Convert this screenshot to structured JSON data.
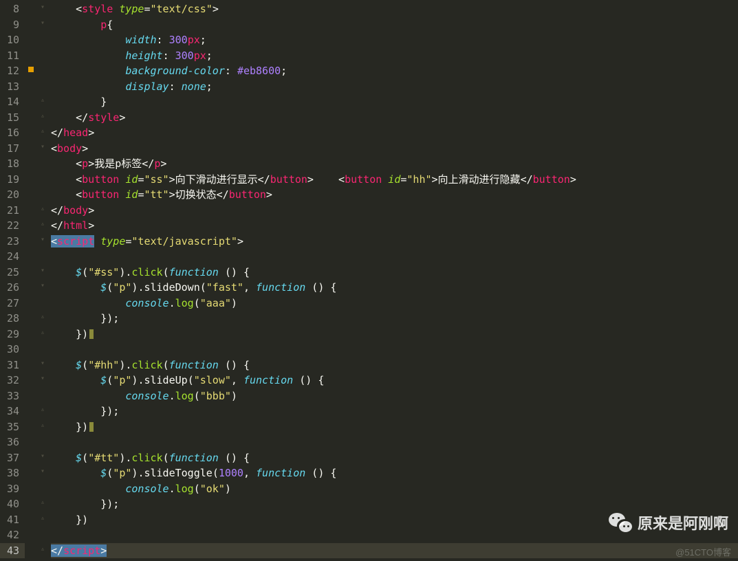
{
  "editor": {
    "first_line": 8,
    "active_line": 43,
    "marked_lines": [
      12
    ]
  },
  "watermark": {
    "text": "原来是阿刚啊",
    "credit": "@51CTO博客"
  },
  "code": {
    "lines": [
      {
        "n": 8,
        "tokens": [
          [
            "    ",
            ""
          ],
          [
            "<",
            "p-white"
          ],
          [
            "style",
            "p-tag"
          ],
          [
            " ",
            ""
          ],
          [
            "type",
            "p-attr"
          ],
          [
            "=",
            "p-white"
          ],
          [
            "\"text/css\"",
            "p-str"
          ],
          [
            ">",
            "p-white"
          ]
        ]
      },
      {
        "n": 9,
        "tokens": [
          [
            "        ",
            ""
          ],
          [
            "p",
            "p-tag"
          ],
          [
            "{",
            "p-white"
          ]
        ]
      },
      {
        "n": 10,
        "tokens": [
          [
            "            ",
            ""
          ],
          [
            "width",
            "p-prop"
          ],
          [
            ": ",
            "p-white"
          ],
          [
            "300",
            "p-num"
          ],
          [
            "px",
            "p-unit"
          ],
          [
            ";",
            "p-white"
          ]
        ]
      },
      {
        "n": 11,
        "tokens": [
          [
            "            ",
            ""
          ],
          [
            "height",
            "p-prop"
          ],
          [
            ": ",
            "p-white"
          ],
          [
            "300",
            "p-num"
          ],
          [
            "px",
            "p-unit"
          ],
          [
            ";",
            "p-white"
          ]
        ]
      },
      {
        "n": 12,
        "tokens": [
          [
            "            ",
            ""
          ],
          [
            "background-color",
            "p-prop"
          ],
          [
            ": ",
            "p-white"
          ],
          [
            "#eb8600",
            "p-num"
          ],
          [
            ";",
            "p-white"
          ]
        ]
      },
      {
        "n": 13,
        "tokens": [
          [
            "            ",
            ""
          ],
          [
            "display",
            "p-prop"
          ],
          [
            ": ",
            "p-white"
          ],
          [
            "none",
            "p-attr2"
          ],
          [
            ";",
            "p-white"
          ]
        ]
      },
      {
        "n": 14,
        "tokens": [
          [
            "        ",
            ""
          ],
          [
            "}",
            "p-white"
          ]
        ]
      },
      {
        "n": 15,
        "tokens": [
          [
            "    ",
            ""
          ],
          [
            "</",
            "p-white"
          ],
          [
            "style",
            "p-tag"
          ],
          [
            ">",
            "p-white"
          ]
        ]
      },
      {
        "n": 16,
        "tokens": [
          [
            "</",
            "p-white"
          ],
          [
            "head",
            "p-tag"
          ],
          [
            ">",
            "p-white"
          ]
        ]
      },
      {
        "n": 17,
        "tokens": [
          [
            "<",
            "p-white"
          ],
          [
            "body",
            "p-tag"
          ],
          [
            ">",
            "p-white"
          ]
        ]
      },
      {
        "n": 18,
        "tokens": [
          [
            "    ",
            ""
          ],
          [
            "<",
            "p-white"
          ],
          [
            "p",
            "p-tag"
          ],
          [
            ">",
            "p-white"
          ],
          [
            "我是p标签",
            "p-white"
          ],
          [
            "</",
            "p-white"
          ],
          [
            "p",
            "p-tag"
          ],
          [
            ">",
            "p-white"
          ]
        ]
      },
      {
        "n": 19,
        "tokens": [
          [
            "    ",
            ""
          ],
          [
            "<",
            "p-white"
          ],
          [
            "button",
            "p-tag"
          ],
          [
            " ",
            ""
          ],
          [
            "id",
            "p-attr"
          ],
          [
            "=",
            "p-white"
          ],
          [
            "\"ss\"",
            "p-str"
          ],
          [
            ">",
            "p-white"
          ],
          [
            "向下滑动进行显示",
            "p-white"
          ],
          [
            "</",
            "p-white"
          ],
          [
            "button",
            "p-tag"
          ],
          [
            ">",
            "p-white"
          ],
          [
            "    ",
            ""
          ],
          [
            "<",
            "p-white"
          ],
          [
            "button",
            "p-tag"
          ],
          [
            " ",
            ""
          ],
          [
            "id",
            "p-attr"
          ],
          [
            "=",
            "p-white"
          ],
          [
            "\"hh\"",
            "p-str"
          ],
          [
            ">",
            "p-white"
          ],
          [
            "向上滑动进行隐藏",
            "p-white"
          ],
          [
            "</",
            "p-white"
          ],
          [
            "button",
            "p-tag"
          ],
          [
            ">",
            "p-white"
          ]
        ]
      },
      {
        "n": 20,
        "tokens": [
          [
            "    ",
            ""
          ],
          [
            "<",
            "p-white"
          ],
          [
            "button",
            "p-tag"
          ],
          [
            " ",
            ""
          ],
          [
            "id",
            "p-attr"
          ],
          [
            "=",
            "p-white"
          ],
          [
            "\"tt\"",
            "p-str"
          ],
          [
            ">",
            "p-white"
          ],
          [
            "切换状态",
            "p-white"
          ],
          [
            "</",
            "p-white"
          ],
          [
            "button",
            "p-tag"
          ],
          [
            ">",
            "p-white"
          ]
        ]
      },
      {
        "n": 21,
        "tokens": [
          [
            "</",
            "p-white"
          ],
          [
            "body",
            "p-tag"
          ],
          [
            ">",
            "p-white"
          ]
        ]
      },
      {
        "n": 22,
        "tokens": [
          [
            "</",
            "p-white"
          ],
          [
            "html",
            "p-tag"
          ],
          [
            ">",
            "p-white"
          ]
        ]
      },
      {
        "n": 23,
        "tokens": [
          [
            "<",
            "p-white hl-script-open"
          ],
          [
            "script",
            "p-tag hl-script-open"
          ],
          [
            " ",
            ""
          ],
          [
            "type",
            "p-attr"
          ],
          [
            "=",
            "p-white"
          ],
          [
            "\"text/javascript\"",
            "p-str"
          ],
          [
            ">",
            "p-white"
          ]
        ]
      },
      {
        "n": 24,
        "tokens": [
          [
            "",
            ""
          ]
        ]
      },
      {
        "n": 25,
        "tokens": [
          [
            "    ",
            ""
          ],
          [
            "$",
            "p-var"
          ],
          [
            "(",
            "p-white"
          ],
          [
            "\"#ss\"",
            "p-str"
          ],
          [
            ")",
            "p-white"
          ],
          [
            ".",
            "p-white"
          ],
          [
            "click",
            "p-func"
          ],
          [
            "(",
            "p-white"
          ],
          [
            "function",
            "p-attr2"
          ],
          [
            " () {",
            "p-white"
          ]
        ]
      },
      {
        "n": 26,
        "tokens": [
          [
            "        ",
            ""
          ],
          [
            "$",
            "p-var"
          ],
          [
            "(",
            "p-white"
          ],
          [
            "\"p\"",
            "p-str"
          ],
          [
            ")",
            "p-white"
          ],
          [
            ".",
            "p-white"
          ],
          [
            "slideDown",
            "p-white"
          ],
          [
            "(",
            "p-white"
          ],
          [
            "\"fast\"",
            "p-str"
          ],
          [
            ",",
            "p-white"
          ],
          [
            " ",
            ""
          ],
          [
            "function",
            "p-attr2"
          ],
          [
            " () {",
            "p-white"
          ]
        ]
      },
      {
        "n": 27,
        "tokens": [
          [
            "            ",
            ""
          ],
          [
            "console",
            "p-var"
          ],
          [
            ".",
            "p-white"
          ],
          [
            "log",
            "p-func"
          ],
          [
            "(",
            "p-white"
          ],
          [
            "\"aaa\"",
            "p-str"
          ],
          [
            ")",
            "p-white"
          ]
        ]
      },
      {
        "n": 28,
        "tokens": [
          [
            "        ",
            ""
          ],
          [
            "});",
            "p-white"
          ]
        ]
      },
      {
        "n": 29,
        "tokens": [
          [
            "    ",
            ""
          ],
          [
            "})",
            "p-white"
          ],
          [
            " ",
            "warn-mark"
          ]
        ]
      },
      {
        "n": 30,
        "tokens": [
          [
            "",
            ""
          ]
        ]
      },
      {
        "n": 31,
        "tokens": [
          [
            "    ",
            ""
          ],
          [
            "$",
            "p-var"
          ],
          [
            "(",
            "p-white"
          ],
          [
            "\"#hh\"",
            "p-str"
          ],
          [
            ")",
            "p-white"
          ],
          [
            ".",
            "p-white"
          ],
          [
            "click",
            "p-func"
          ],
          [
            "(",
            "p-white"
          ],
          [
            "function",
            "p-attr2"
          ],
          [
            " () {",
            "p-white"
          ]
        ]
      },
      {
        "n": 32,
        "tokens": [
          [
            "        ",
            ""
          ],
          [
            "$",
            "p-var"
          ],
          [
            "(",
            "p-white"
          ],
          [
            "\"p\"",
            "p-str"
          ],
          [
            ")",
            "p-white"
          ],
          [
            ".",
            "p-white"
          ],
          [
            "slideUp",
            "p-white"
          ],
          [
            "(",
            "p-white"
          ],
          [
            "\"slow\"",
            "p-str"
          ],
          [
            ",",
            "p-white"
          ],
          [
            " ",
            ""
          ],
          [
            "function",
            "p-attr2"
          ],
          [
            " () {",
            "p-white"
          ]
        ]
      },
      {
        "n": 33,
        "tokens": [
          [
            "            ",
            ""
          ],
          [
            "console",
            "p-var"
          ],
          [
            ".",
            "p-white"
          ],
          [
            "log",
            "p-func"
          ],
          [
            "(",
            "p-white"
          ],
          [
            "\"bbb\"",
            "p-str"
          ],
          [
            ")",
            "p-white"
          ]
        ]
      },
      {
        "n": 34,
        "tokens": [
          [
            "        ",
            ""
          ],
          [
            "});",
            "p-white"
          ]
        ]
      },
      {
        "n": 35,
        "tokens": [
          [
            "    ",
            ""
          ],
          [
            "})",
            "p-white"
          ],
          [
            " ",
            "warn-mark"
          ]
        ]
      },
      {
        "n": 36,
        "tokens": [
          [
            "",
            ""
          ]
        ]
      },
      {
        "n": 37,
        "tokens": [
          [
            "    ",
            ""
          ],
          [
            "$",
            "p-var"
          ],
          [
            "(",
            "p-white"
          ],
          [
            "\"#tt\"",
            "p-str"
          ],
          [
            ")",
            "p-white"
          ],
          [
            ".",
            "p-white"
          ],
          [
            "click",
            "p-func"
          ],
          [
            "(",
            "p-white"
          ],
          [
            "function",
            "p-attr2"
          ],
          [
            " () {",
            "p-white"
          ]
        ]
      },
      {
        "n": 38,
        "tokens": [
          [
            "        ",
            ""
          ],
          [
            "$",
            "p-var"
          ],
          [
            "(",
            "p-white"
          ],
          [
            "\"p\"",
            "p-str"
          ],
          [
            ")",
            "p-white"
          ],
          [
            ".",
            "p-white"
          ],
          [
            "slideToggle",
            "p-white"
          ],
          [
            "(",
            "p-white"
          ],
          [
            "1000",
            "p-num"
          ],
          [
            ",",
            "p-white"
          ],
          [
            " ",
            ""
          ],
          [
            "function",
            "p-attr2"
          ],
          [
            " () {",
            "p-white"
          ]
        ]
      },
      {
        "n": 39,
        "tokens": [
          [
            "            ",
            ""
          ],
          [
            "console",
            "p-var"
          ],
          [
            ".",
            "p-white"
          ],
          [
            "log",
            "p-func"
          ],
          [
            "(",
            "p-white"
          ],
          [
            "\"ok\"",
            "p-str"
          ],
          [
            ")",
            "p-white"
          ]
        ]
      },
      {
        "n": 40,
        "tokens": [
          [
            "        ",
            ""
          ],
          [
            "});",
            "p-white"
          ]
        ]
      },
      {
        "n": 41,
        "tokens": [
          [
            "    ",
            ""
          ],
          [
            "})",
            "p-white"
          ]
        ]
      },
      {
        "n": 42,
        "tokens": [
          [
            "",
            ""
          ]
        ]
      },
      {
        "n": 43,
        "tokens": [
          [
            "</",
            "p-white hl-script-close"
          ],
          [
            "script",
            "p-tag hl-script-close"
          ],
          [
            ">",
            "p-white hl-script-close"
          ]
        ]
      }
    ]
  }
}
